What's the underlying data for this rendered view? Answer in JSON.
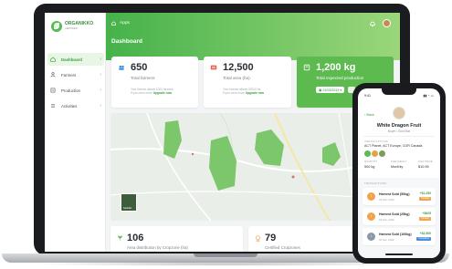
{
  "app": {
    "logo_name": "ORGANIKKO",
    "logo_sub": "CERTIFIED",
    "breadcrumb_icon": "home-icon",
    "breadcrumb_label": "Apps",
    "page_title": "Dashboard",
    "brand_color": "#46b24a"
  },
  "sidebar": {
    "items": [
      {
        "label": "Dashboard",
        "icon": "home-icon",
        "active": true
      },
      {
        "label": "Farmers",
        "icon": "farmer-icon",
        "active": false
      },
      {
        "label": "Production",
        "icon": "production-icon",
        "active": false
      },
      {
        "label": "Activities",
        "icon": "activities-icon",
        "active": false
      }
    ]
  },
  "stats": [
    {
      "value": "650",
      "label": "Total farmers",
      "hint1": "Your license allows 1000 farmers.",
      "hint2": "If you need more",
      "hint_link": "Upgrade now"
    },
    {
      "value": "12,500",
      "label": "Total area (ha)",
      "hint1": "Your license allows 20000 ha.",
      "hint2": "If you need more",
      "hint_link": "Upgrade now"
    },
    {
      "value": "1,200 kg",
      "label": "Total expected production",
      "chip": "01/03/2019"
    }
  ],
  "bottom_stats": [
    {
      "value": "106",
      "label": "Area distribution by Cropzone (ha)"
    },
    {
      "value": "79",
      "label": "Certified Cropzones"
    }
  ],
  "map": {
    "thumb_label": "Satellite"
  },
  "phone": {
    "time": "9:41",
    "back_label": "Back",
    "title": "White Dragon Fruit",
    "subtitle": "Buyer • Sold Stat",
    "certs_label": "CERTIFICATIONS",
    "certs_value": "ACT Planet, ACT Europe, COR Canada",
    "kv": [
      {
        "k": "QUANTITY",
        "v": "500 kg"
      },
      {
        "k": "FREQUENCY",
        "v": "Monthly"
      },
      {
        "k": "UNIT PRICE",
        "v": "$10.95"
      }
    ],
    "transactions_label": "TRANSACTIONS",
    "transactions": [
      {
        "title": "Harvest Sold (50kg)",
        "date": "23 Feb, 2019",
        "amount": "+$1,250",
        "status": "Pending",
        "color": "#f4a24a"
      },
      {
        "title": "Harvest Sold (25kg)",
        "date": "15 Feb, 2019",
        "amount": "+$625",
        "status": "Pending",
        "color": "#f4a24a"
      },
      {
        "title": "Harvest Sold (100kg)",
        "date": "02 Feb, 2019",
        "amount": "+$2,500",
        "status": "Completed",
        "color": "#8a98a8"
      }
    ]
  }
}
